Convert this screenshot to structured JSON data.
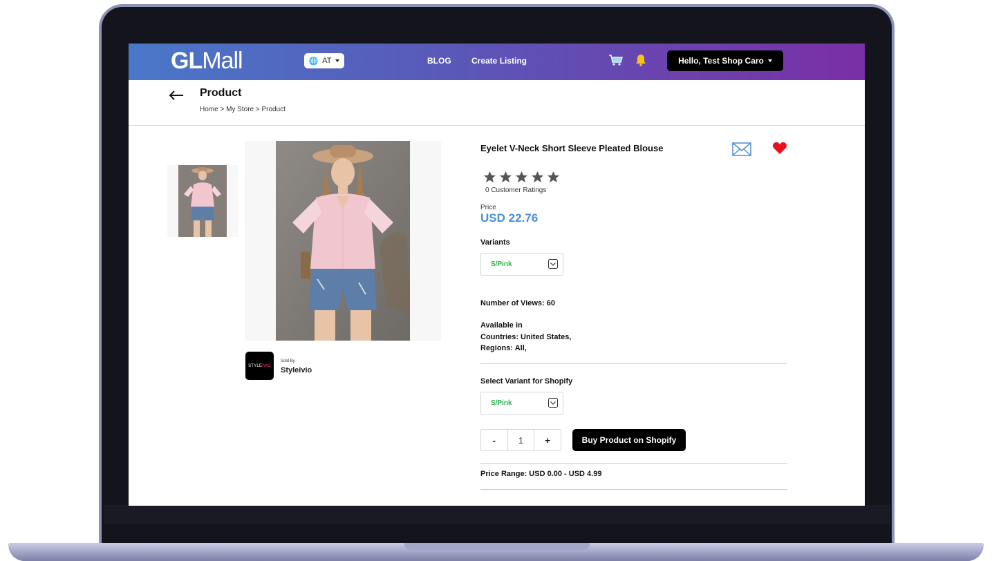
{
  "navbar": {
    "logo_bold": "GL",
    "logo_light": "Mall",
    "country": "AT",
    "links": [
      "BLOG",
      "Create Listing"
    ],
    "user_button": "Hello, Test Shop Caro"
  },
  "header": {
    "title": "Product",
    "breadcrumb": "Home > My Store > Product"
  },
  "seller": {
    "logo_text_a": "STYLE",
    "logo_text_b": "IVIO",
    "sold_by_label": "Sold By",
    "name": "Styleivio"
  },
  "product": {
    "title": "Eyelet V-Neck Short Sleeve Pleated Blouse",
    "rating_stars": 5,
    "ratings_text": "0 Customer Ratings",
    "price_label": "Price",
    "price": "USD 22.76",
    "variants_label": "Variants",
    "variant_selected": "S/Pink",
    "views": "Number of Views: 60",
    "available_label": "Available in",
    "countries": "Countries: United States,",
    "regions": "Regions: All,",
    "shopify_variant_label": "Select Variant for Shopify",
    "shopify_variant_selected": "S/Pink",
    "qty_minus": "-",
    "qty_value": "1",
    "qty_plus": "+",
    "buy_button": "Buy Product on Shopify",
    "price_range": "Price Range: USD 0.00 - USD 4.99"
  },
  "colors": {
    "price": "#4a8fd0",
    "variant": "#2fb04a",
    "heart": "#e8101c",
    "nav_start": "#4a78c8",
    "nav_end": "#7a2fa6"
  }
}
